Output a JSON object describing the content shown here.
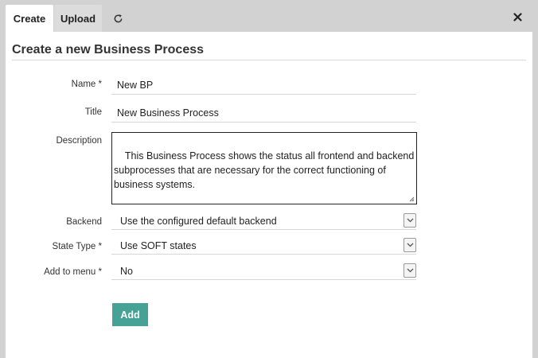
{
  "tabs": {
    "create": "Create",
    "upload": "Upload",
    "refresh_icon": "refresh-icon",
    "close_icon": "close-icon"
  },
  "page": {
    "title": "Create a new Business Process"
  },
  "form": {
    "name": {
      "label": "Name *",
      "value": "New BP"
    },
    "title": {
      "label": "Title",
      "value": "New Business Process"
    },
    "description": {
      "label": "Description",
      "value": "This Business Process shows the status all frontend and backend subprocesses that are necessary for the correct functioning of business systems."
    },
    "backend": {
      "label": "Backend",
      "value": "Use the configured default backend"
    },
    "state_type": {
      "label": "State Type *",
      "value": "Use SOFT states"
    },
    "add_to_menu": {
      "label": "Add to menu *",
      "value": "No"
    },
    "submit_label": "Add"
  },
  "colors": {
    "accent": "#46a294",
    "background": "#d2d2d2",
    "panel": "#ffffff"
  }
}
